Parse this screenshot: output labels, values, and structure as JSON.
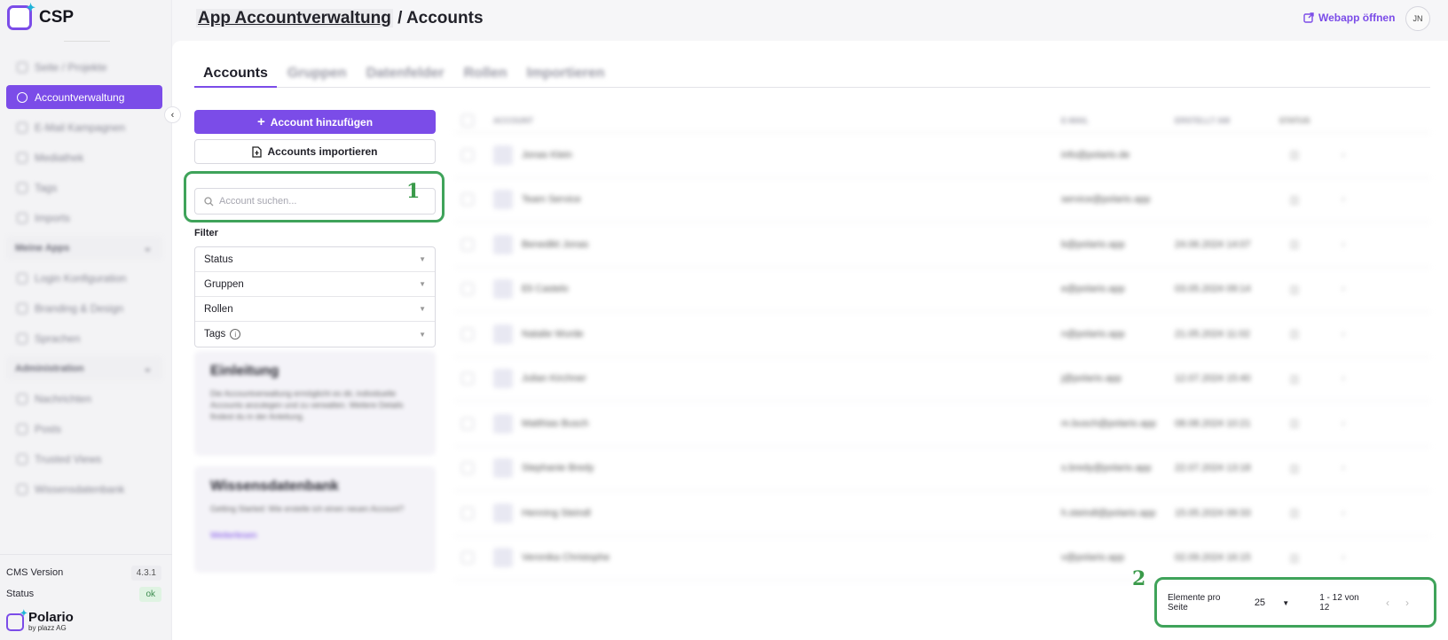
{
  "app": {
    "logo_text": "CSP"
  },
  "sidebar": {
    "items": [
      {
        "label": "Seite / Projekte",
        "active": false
      },
      {
        "label": "Accountverwaltung",
        "active": true
      },
      {
        "label": "E-Mail Kampagnen",
        "active": false
      },
      {
        "label": "Mediathek",
        "active": false
      },
      {
        "label": "Tags",
        "active": false
      },
      {
        "label": "Imports",
        "active": false
      }
    ],
    "section_apps": "Meine Apps",
    "app_items": [
      {
        "label": "Login Konfiguration"
      },
      {
        "label": "Branding & Design"
      },
      {
        "label": "Sprachen"
      }
    ],
    "section_admin": "Administration",
    "admin_items": [
      {
        "label": "Nachrichten"
      },
      {
        "label": "Posts"
      },
      {
        "label": "Trusted Views"
      },
      {
        "label": "Wissensdatenbank"
      }
    ],
    "cms_version_label": "CMS Version",
    "cms_version_value": "4.3.1",
    "status_label": "Status",
    "status_value": "ok",
    "brand_name": "Polario",
    "brand_sub": "by plazz AG"
  },
  "header": {
    "breadcrumb_link": "App Accountverwaltung",
    "breadcrumb_current": "/ Accounts",
    "webapp_link": "Webapp öffnen",
    "avatar_initials": "JN"
  },
  "tabs": [
    {
      "label": "Accounts",
      "active": true
    },
    {
      "label": "Gruppen",
      "active": false
    },
    {
      "label": "Datenfelder",
      "active": false
    },
    {
      "label": "Rollen",
      "active": false
    },
    {
      "label": "Importieren",
      "active": false
    }
  ],
  "actions": {
    "add_account": "Account hinzufügen",
    "import_accounts": "Accounts importieren"
  },
  "search": {
    "placeholder": "Account suchen..."
  },
  "annotations": {
    "one": "1",
    "two": "2"
  },
  "filter": {
    "label": "Filter",
    "rows": [
      {
        "label": "Status"
      },
      {
        "label": "Gruppen"
      },
      {
        "label": "Rollen"
      },
      {
        "label": "Tags"
      }
    ]
  },
  "cards": {
    "intro_title": "Einleitung",
    "intro_text": "Die Accountverwaltung ermöglicht es dir, individuelle Accounts anzulegen und zu verwalten. Weitere Details findest du in der Anleitung.",
    "kb_title": "Wissensdatenbank",
    "kb_text": "Getting Started: Wie erstelle ich einen neuen Account?",
    "kb_link": "Weiterlesen"
  },
  "table": {
    "headers": {
      "account": "ACCOUNT",
      "email": "E-MAIL",
      "date": "ERSTELLT AM",
      "icon": "STATUS"
    },
    "rows": [
      {
        "name": "Jonas Klein",
        "email": "info@polario.de",
        "date": ""
      },
      {
        "name": "Team Service",
        "email": "service@polario.app",
        "date": ""
      },
      {
        "name": "Benedikt Jonas",
        "email": "b@polario.app",
        "date": "24.06.2024 14:07"
      },
      {
        "name": "Eli Castelo",
        "email": "e@polario.app",
        "date": "03.05.2024 09:14"
      },
      {
        "name": "Natalie Wurde",
        "email": "n@polario.app",
        "date": "21.05.2024 11:02"
      },
      {
        "name": "Julian Kirchner",
        "email": "j@polario.app",
        "date": "12.07.2024 15:40"
      },
      {
        "name": "Matthias Busch",
        "email": "m.busch@polario.app",
        "date": "08.08.2024 10:21"
      },
      {
        "name": "Stephanie Bredy",
        "email": "s.bredy@polario.app",
        "date": "22.07.2024 13:18"
      },
      {
        "name": "Henning Steindl",
        "email": "h.steindl@polario.app",
        "date": "15.05.2024 09:33"
      },
      {
        "name": "Veronika Christophe",
        "email": "v@polario.app",
        "date": "02.09.2024 16:15"
      }
    ]
  },
  "pagination": {
    "per_page_label": "Elemente pro Seite",
    "per_page_value": "25",
    "range": "1 - 12 von 12"
  }
}
